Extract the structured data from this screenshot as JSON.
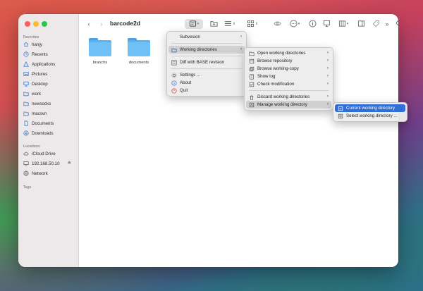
{
  "window": {
    "title": "barcode2d"
  },
  "sidebar": {
    "favorites_label": "Favorites",
    "locations_label": "Locations",
    "tags_label": "Tags",
    "favorites": [
      {
        "label": "hanjy",
        "icon": "home-icon"
      },
      {
        "label": "Recents",
        "icon": "clock-icon"
      },
      {
        "label": "Applications",
        "icon": "applications-icon"
      },
      {
        "label": "Pictures",
        "icon": "pictures-icon"
      },
      {
        "label": "Desktop",
        "icon": "desktop-icon"
      },
      {
        "label": "work",
        "icon": "folder-icon"
      },
      {
        "label": "newsocks",
        "icon": "folder-icon"
      },
      {
        "label": "macsvn",
        "icon": "folder-icon"
      },
      {
        "label": "Documents",
        "icon": "document-icon"
      },
      {
        "label": "Downloads",
        "icon": "download-icon"
      }
    ],
    "locations": [
      {
        "label": "iCloud Drive",
        "icon": "cloud-icon"
      },
      {
        "label": "192.168.50.10",
        "icon": "server-icon"
      },
      {
        "label": "Network",
        "icon": "network-icon"
      }
    ]
  },
  "files": [
    {
      "name": "branchs"
    },
    {
      "name": "documents"
    }
  ],
  "menu_main": {
    "items": [
      "Subvesion",
      "Working directories",
      "Diff with BASE revision",
      "Settings ...",
      "About",
      "Quit"
    ]
  },
  "menu_working": {
    "items": [
      "Open working directories",
      "Browse repository",
      "Browse working-copy",
      "Show log",
      "Check modification",
      "Discard working directories",
      "Manage working directory"
    ]
  },
  "menu_manage": {
    "items": [
      "Current working directory",
      "Select working directory ..."
    ]
  },
  "colors": {
    "accent": "#2f6fd6",
    "folder": "#5cb2ee"
  }
}
